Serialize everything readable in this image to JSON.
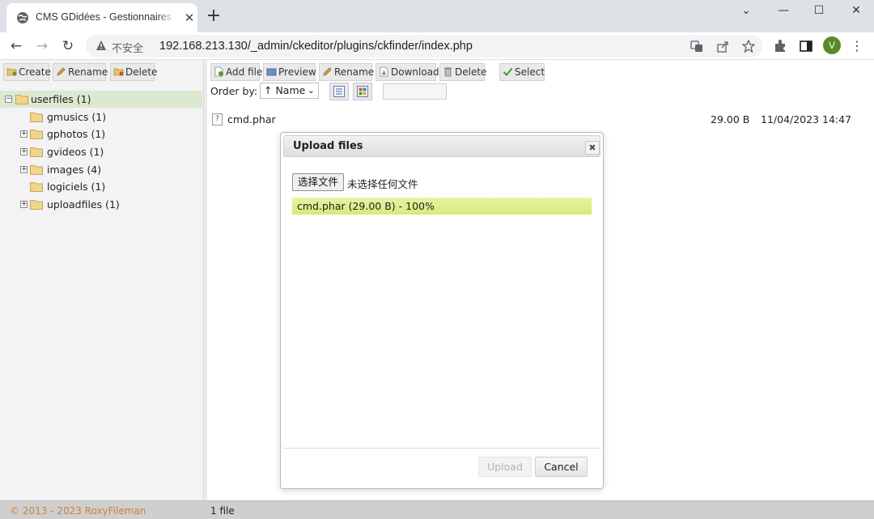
{
  "browser": {
    "tab_title": "CMS GDidées - Gestionnaires de",
    "security_label": "不安全",
    "url": "192.168.213.130/_admin/ckeditor/plugins/ckfinder/index.php",
    "avatar_letter": "V",
    "accent": "#5a8a24"
  },
  "left_toolbar": {
    "create": "Create",
    "rename": "Rename",
    "delete": "Delete"
  },
  "right_toolbar": {
    "add_file": "Add file",
    "preview": "Preview",
    "rename": "Rename",
    "download": "Download",
    "delete": "Delete",
    "select": "Select"
  },
  "sort": {
    "label": "Order by:",
    "value": "↑ Name"
  },
  "tree": [
    {
      "label": "userfiles (1)",
      "expander": "−"
    },
    {
      "label": "gmusics (1)",
      "expander": ""
    },
    {
      "label": "gphotos (1)",
      "expander": "+"
    },
    {
      "label": "gvideos (1)",
      "expander": "+"
    },
    {
      "label": "images (4)",
      "expander": "+"
    },
    {
      "label": "logiciels (1)",
      "expander": ""
    },
    {
      "label": "uploadfiles (1)",
      "expander": "+"
    }
  ],
  "files": [
    {
      "name": "cmd.phar",
      "size": "29.00 B",
      "date": "11/04/2023 14:47"
    }
  ],
  "status": {
    "copyright": "© 2013 - 2023 RoxyFileman",
    "count": "1 file"
  },
  "dialog": {
    "title": "Upload files",
    "close": "✖",
    "choose_file": "选择文件",
    "no_file": "未选择任何文件",
    "progress_text": "cmd.phar (29.00 B) - 100%",
    "progress": 1.0,
    "upload": "Upload",
    "cancel": "Cancel"
  }
}
